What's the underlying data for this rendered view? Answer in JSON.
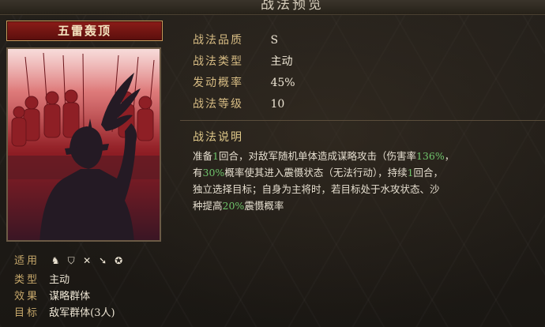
{
  "window": {
    "title": "战法预览"
  },
  "card": {
    "name": "五雷轰顶"
  },
  "info": {
    "applicable_label": "适用",
    "applicable_icons": [
      "cavalry-icon",
      "shield-icon",
      "crossbow-icon",
      "spear-icon",
      "gear-icon"
    ],
    "type_label": "类型",
    "type_value": "主动",
    "effect_label": "效果",
    "effect_value": "谋略群体",
    "target_label": "目标",
    "target_value": "敌军群体(3人)"
  },
  "stats": [
    {
      "label": "战法品质",
      "value": "S"
    },
    {
      "label": "战法类型",
      "value": "主动"
    },
    {
      "label": "发动概率",
      "value": "45%"
    },
    {
      "label": "战法等级",
      "value": "10"
    }
  ],
  "description": {
    "title": "战法说明",
    "line1": {
      "a": "准备",
      "b": "1",
      "c": "回合，对敌军随机单体造成谋略攻击（伤害率",
      "d": "136%",
      "e": "，"
    },
    "line2": {
      "a": "有",
      "b": "30%",
      "c": "概率使其进入震慑状态（无法行动），持续",
      "d": "1",
      "e": "回合，"
    },
    "line3": "独立选择目标；自身为主将时，若目标处于水攻状态、沙",
    "line4": {
      "a": "种提高",
      "b": "20%",
      "c": "震慑概率"
    }
  }
}
